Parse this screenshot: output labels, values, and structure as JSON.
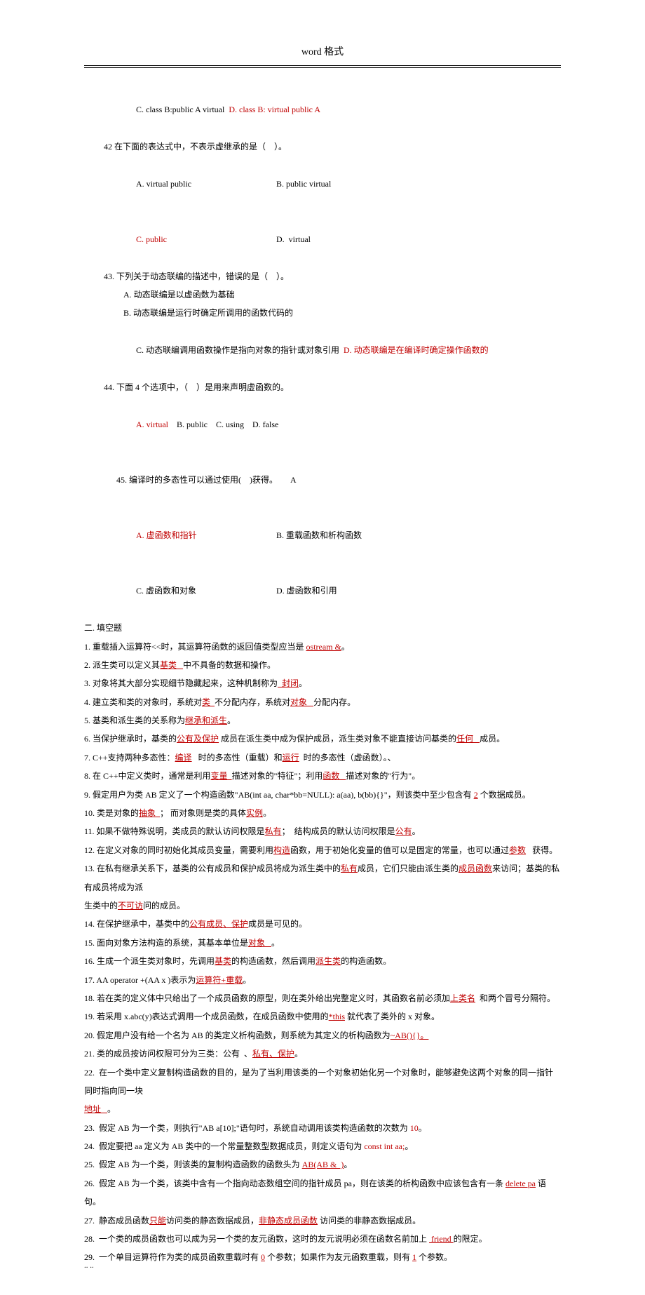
{
  "header": "word 格式",
  "footer": ".. ..",
  "q41_c": "C. class B:public A virtual",
  "q41_d": "D. class B: virtual public A",
  "q42_stem": "42 在下面的表达式中，不表示虚继承的是（　）。",
  "q42_a": "A. virtual public",
  "q42_b": "B. public virtual",
  "q42_c": "C. public",
  "q42_d": "D.  virtual",
  "q43_stem": "43. 下列关于动态联编的描述中，错误的是（　）。",
  "q43_a": "A. 动态联编是以虚函数为基础",
  "q43_b": "B. 动态联编是运行时确定所调用的函数代码的",
  "q43_c": "C. 动态联编调用函数操作是指向对象的指针或对象引用",
  "q43_d": "D. 动态联编是在编译时确定操作函数的",
  "q44_stem": "44. 下面 4 个选项中，（　）是用来声明虚函数的。",
  "q44_a": "A. virtual",
  "q44_b": "B. public",
  "q44_c": "C. using",
  "q44_d": "D. false",
  "q45_stem": "45. 编译时的多态性可以通过使用(　)获得。",
  "q45_ans": "A",
  "q45_a": "A. 虚函数和指针",
  "q45_b": "B. 重载函数和析构函数",
  "q45_c": "C. 虚函数和对象",
  "q45_d": "D. 虚函数和引用",
  "section2": "二. 填空题",
  "f1a": "1. 重载插入运算符<<时，其运算符函数的返回值类型应当是 ",
  "f1b": "ostream &",
  "f1c": "。",
  "f2a": "2. 派生类可以定义其",
  "f2b": "基类   ",
  "f2c": "中不具备的数据和操作。",
  "f3a": "3. 对象将其大部分实现细节隐藏起来，这种机制称为",
  "f3b": "  封闭",
  "f3c": "。",
  "f4a": "4. 建立类和类的对象时，系统对",
  "f4b": "类  ",
  "f4c": "不分配内存，系统对",
  "f4d": "对象   ",
  "f4e": "分配内存。",
  "f5a": "5. 基类和派生类的关系称为",
  "f5b": "继承和派生",
  "f5c": "。",
  "f6a": "6. 当保护继承时，基类的",
  "f6b": "公有及保护",
  "f6c": " 成员在派生类中成为保护成员，派生类对象不能直接访问基类的",
  "f6d": "任何   ",
  "f6e": "成员。",
  "f7a": "7. C++支持两种多态性：",
  "f7b": "编译",
  "f7c": "   时的多态性（重载）和",
  "f7d": "运行",
  "f7e": "  时的多态性（虚函数）。、",
  "f8a": "8. 在 C++中定义类时，通常是利用",
  "f8b": "变量  ",
  "f8c": "描述对象的\"特征\"；利用",
  "f8d": "函数   ",
  "f8e": "描述对象的\"行为\"。",
  "f9a": "9. 假定用户为类 AB 定义了一个构造函数\"AB(int aa, char*bb=NULL): a(aa), b(bb){}\"，则该类中至少包含有 ",
  "f9b": "2",
  "f9c": " 个数据成员。",
  "f10a": "10. 类是对象的",
  "f10b": "抽象  ",
  "f10c": "； 而对象则是类的具体",
  "f10d": "实例",
  "f10e": "。",
  "f11a": "11. 如果不做特殊说明，类成员的默认访问权限是",
  "f11b": "私有",
  "f11c": "；  结构成员的默认访问权限是",
  "f11d": "公有",
  "f11e": "。",
  "f12a": "12. 在定义对象的同时初始化其成员变量，需要利用",
  "f12b": "构造",
  "f12c": "函数，用于初始化变量的值可以是固定的常量，也可以通过",
  "f12d": "参数",
  "f12e": "   获得。",
  "f13a": "13. 在私有继承关系下，基类的公有成员和保护成员将成为派生类中的",
  "f13b": "私有",
  "f13c": "成员，它们只能由派生类的",
  "f13d": "成员函数",
  "f13e": "来访问；基类的私有成员将成为派",
  "f13f": "生类中的",
  "f13g": "不可访",
  "f13h": "问的成员。",
  "f14a": "14. 在保护继承中，基类中的",
  "f14b": "公有成员、保护",
  "f14c": "成员是可见的。",
  "f15a": "15. 面向对象方法构造的系统，其基本单位是",
  "f15b": "对象   ",
  "f15c": "。",
  "f16a": "16. 生成一个派生类对象时，先调用",
  "f16b": "基类",
  "f16c": "的构造函数，然后调用",
  "f16d": "派生类",
  "f16e": "的构造函数。",
  "f17a": "17. AA operator +(AA x )表示为",
  "f17b": "运算符+重载",
  "f17c": "。",
  "f18a": "18. 若在类的定义体中只给出了一个成员函数的原型，则在类外给出完整定义时，其函数名前必须加",
  "f18b": "上类名",
  "f18c": "  和两个冒号分隔符。",
  "f19a": "19. 若采用 x.abc(y)表达式调用一个成员函数，在成员函数中使用的",
  "f19b": "*this",
  "f19c": " 就代表了类外的 x 对象。",
  "f20a": "20. 假定用户没有给一个名为 AB 的类定义析构函数，则系统为其定义的析构函数为",
  "f20b": "~AB(){}。",
  "f21a": "21. 类的成员按访问权限可分为三类：公有  、",
  "f21b": "私有、保护",
  "f21c": "。",
  "f22a": "22.  在一个类中定义复制构造函数的目的，是为了当利用该类的一个对象初始化另一个对象时，能够避免这两个对象的同一指针同时指向同一块",
  "f22b": "地址   ",
  "f22c": "。",
  "f23a": "23.  假定 AB 为一个类，则执行\"AB a[10];\"语句时，系统自动调用该类构造函数的次数为 ",
  "f23b": "10",
  "f23c": "。",
  "f24a": "24.  假定要把 aa 定义为 AB 类中的一个常量整数型数据成员，则定义语句为 ",
  "f24b": "const int aa;",
  "f24c": "。",
  "f25a": "25.  假定 AB 为一个类，则该类的复制构造函数的函数头为 ",
  "f25b": "AB(AB &  )",
  "f25c": "。",
  "f26a": "26.  假定 AB 为一个类，该类中含有一个指向动态数组空间的指针成员 pa，则在该类的析构函数中应该包含有一条 ",
  "f26b": "delete pa",
  "f26c": " 语句。",
  "f27a": "27.  静态成员函数",
  "f27b": "只能",
  "f27c": "访问类的静态数据成员，",
  "f27d": "非静态成员函数",
  "f27e": " 访问类的非静态数据成员。",
  "f28a": "28.  一个类的成员函数也可以成为另一个类的友元函数，这时的友元说明必须在函数名前加上 ",
  "f28b": " friend ",
  "f28c": "的限定。",
  "f29a": "29.  一个单目运算符作为类的成员函数重载时有 ",
  "f29b": "0",
  "f29c": " 个参数；如果作为友元函数重载，则有 ",
  "f29d": "1",
  "f29e": " 个参数。"
}
